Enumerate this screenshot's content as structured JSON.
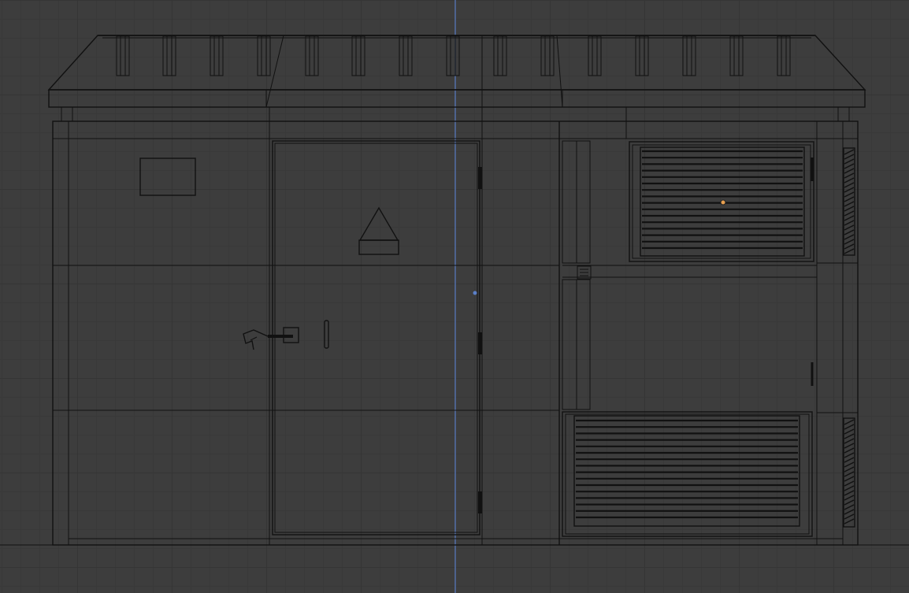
{
  "viewport": {
    "mode": "wireframe",
    "view": "front-orthographic",
    "colors": {
      "background": "#3d3d3d",
      "grid_minor": "#393939",
      "grid_major": "#353535",
      "wire": "#111111",
      "z_axis": "#5b7fc7",
      "origin": "#e8a050"
    }
  },
  "scene": {
    "object": "electrical-substation-kiosk",
    "components": [
      "roof",
      "main-door",
      "warning-sign",
      "nameplate",
      "door-handle",
      "padlock-hasp",
      "upper-vent",
      "lower-vent",
      "side-grilles"
    ]
  }
}
